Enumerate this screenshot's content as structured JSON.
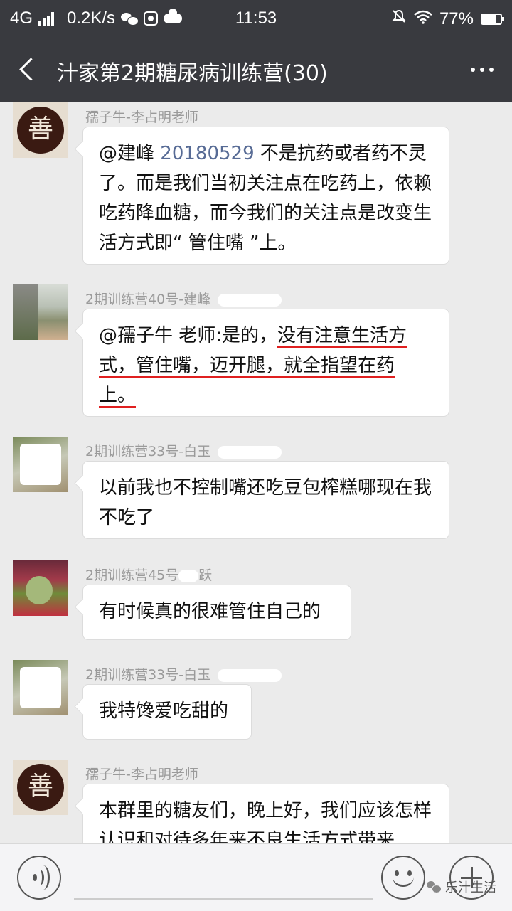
{
  "status_bar": {
    "network": "4G",
    "speed": "0.2K/s",
    "time": "11:53",
    "battery": "77%",
    "battery_level": 0.77,
    "icons": [
      "signal-icon",
      "wechat-icon",
      "app-icon",
      "cloud-icon",
      "mute-bell-icon",
      "wifi-icon",
      "battery-icon"
    ]
  },
  "header": {
    "title": "汁家第2期糖尿病训练营(30)"
  },
  "messages": [
    {
      "sender": "孺子牛-李占明老师",
      "avatar_text": "善",
      "mention": "@建峰",
      "mention_id": "20180529",
      "text": "不是抗药或者药不灵了。而是我们当初关注点在吃药上，依赖吃药降血糖，而今我们的关注点是改变生活方式即“ 管住嘴 ”上。"
    },
    {
      "sender": "2期训练营40号-建峰",
      "text_a": "@孺子牛  老师:是的，",
      "text_b": "没有注意生活方",
      "text_c": "式，管住嘴，迈开腿，就全指望在药",
      "text_d": "上。"
    },
    {
      "sender": "2期训练营33号-白玉",
      "text": "以前我也不控制嘴还吃豆包榨糕哪现在我不吃了"
    },
    {
      "sender_a": "2期训练营45号",
      "sender_b": "跃",
      "text": "有时候真的很难管住自己的"
    },
    {
      "sender": "2期训练营33号-白玉",
      "text": "我特馋爱吃甜的"
    },
    {
      "sender": "孺子牛-李占明老师",
      "avatar_text": "善",
      "text": "本群里的糖友们，晚上好，我们应该怎样认识和对待多年来不良生活方式带来"
    }
  ],
  "watermark": {
    "text": "乐汁生活"
  },
  "colors": {
    "bar": "#393a3f",
    "background": "#ebebeb",
    "mention": "#576b95",
    "underline": "#e02020"
  }
}
